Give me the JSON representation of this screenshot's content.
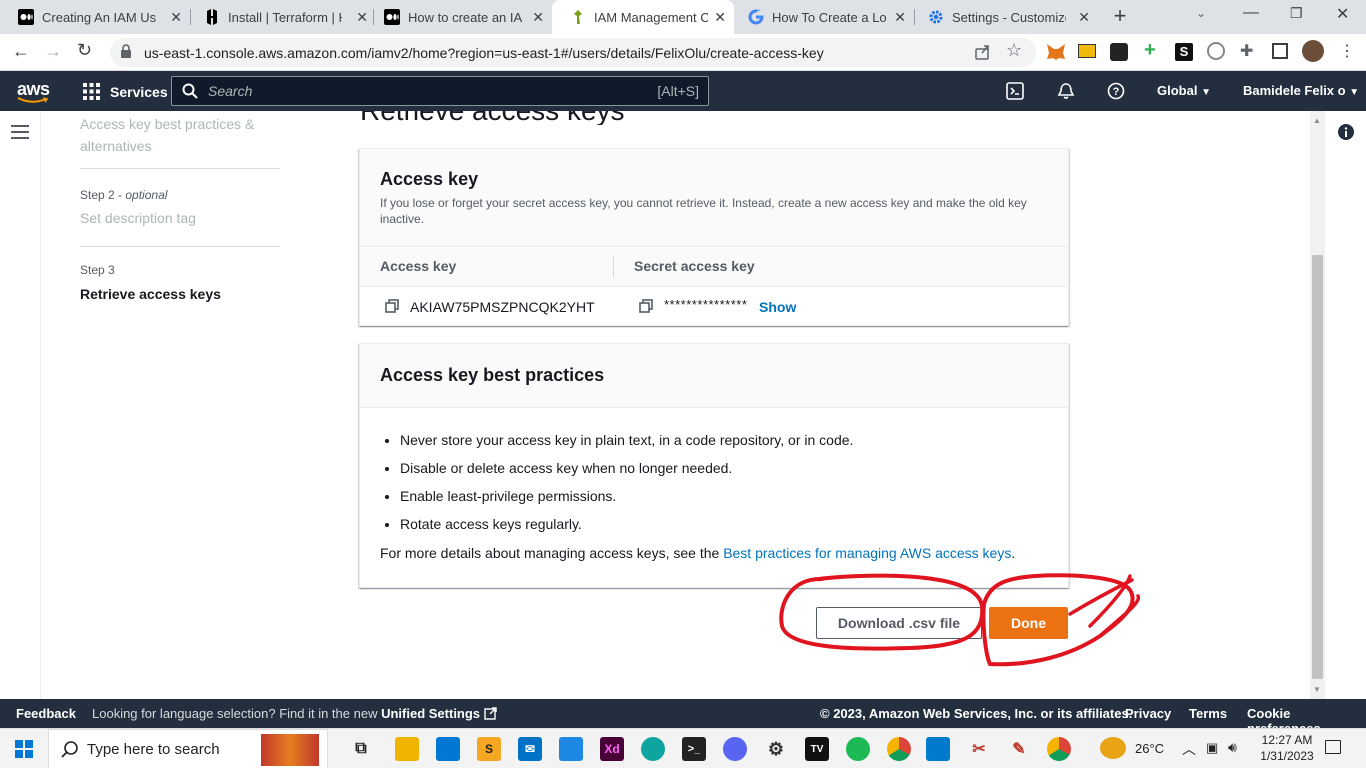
{
  "browser": {
    "tabs": [
      {
        "title": "Creating An IAM User",
        "icon": "medium-icon"
      },
      {
        "title": "Install | Terraform | HashiCorp",
        "icon": "hashicorp-icon"
      },
      {
        "title": "How to create an IAM",
        "icon": "medium-icon"
      },
      {
        "title": "IAM Management Console",
        "icon": "aws-icon"
      },
      {
        "title": "How To Create a Load",
        "icon": "google-icon"
      },
      {
        "title": "Settings - Customize",
        "icon": "gear-icon"
      }
    ],
    "url": "us-east-1.console.aws.amazon.com/iamv2/home?region=us-east-1#/users/details/FelixOlu/create-access-key"
  },
  "awsnav": {
    "logo": "aws",
    "services": "Services",
    "search_placeholder": "Search",
    "search_shortcut": "[Alt+S]",
    "region": "Global",
    "user": "Bamidele Felix o"
  },
  "sidebar": {
    "step1_label": "Access key best practices & alternatives",
    "step2_caption": "Step 2",
    "step2_optional": "optional",
    "step2_label": "Set description tag",
    "step3_caption": "Step 3",
    "step3_label": "Retrieve access keys"
  },
  "main": {
    "page_title": "Retrieve access keys",
    "access_key_panel": {
      "title": "Access key",
      "description": "If you lose or forget your secret access key, you cannot retrieve it. Instead, create a new access key and make the old key inactive.",
      "col1_header": "Access key",
      "col2_header": "Secret access key",
      "access_key_value": "AKIAW75PMSZPNCQK2YHT",
      "secret_masked": "***************",
      "show_label": "Show"
    },
    "best_practices_panel": {
      "title": "Access key best practices",
      "items": [
        "Never store your access key in plain text, in a code repository, or in code.",
        "Disable or delete access key when no longer needed.",
        "Enable least-privilege permissions.",
        "Rotate access keys regularly."
      ],
      "more_prefix": "For more details about managing access keys, see the",
      "more_link": "Best practices for managing AWS access keys",
      "more_suffix": "."
    },
    "download_button": "Download .csv file",
    "done_button": "Done"
  },
  "footer": {
    "feedback": "Feedback",
    "language_prefix": "Looking for language selection? Find it in the new",
    "unified_settings": "Unified Settings",
    "copyright": "© 2023, Amazon Web Services, Inc. or its affiliates.",
    "privacy": "Privacy",
    "terms": "Terms",
    "cookie": "Cookie preferences"
  },
  "taskbar": {
    "search_placeholder": "Type here to search",
    "temperature": "26°C",
    "time": "12:27 AM",
    "date": "1/31/2023"
  },
  "colors": {
    "aws_nav": "#232f3e",
    "link_blue": "#0073bb",
    "done_orange": "#ec7211",
    "annotation_red": "#e0141e"
  }
}
